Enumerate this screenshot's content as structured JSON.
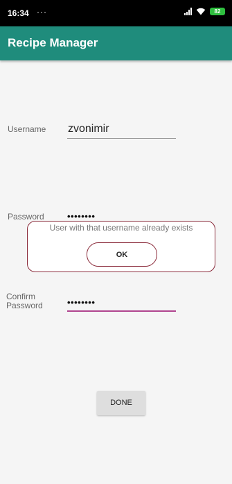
{
  "status_bar": {
    "time": "16:34",
    "notifications": "···",
    "battery": "82"
  },
  "app_bar": {
    "title": "Recipe Manager"
  },
  "form": {
    "username_label": "Username",
    "username_value": "zvonimir",
    "password_label": "Password",
    "password_value": "••••••••",
    "confirm_label_line1": "Confirm",
    "confirm_label_line2": "Password",
    "confirm_value": "••••••••",
    "done_label": "DONE"
  },
  "dialog": {
    "message": "User with that username already exists",
    "ok_label": "OK"
  },
  "colors": {
    "app_bar": "#1f8c7c",
    "dialog_border": "#8a2a3a",
    "active_underline": "#b0448f"
  }
}
